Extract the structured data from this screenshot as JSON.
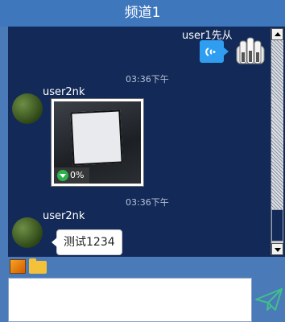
{
  "window": {
    "title": "频道1"
  },
  "messages": [
    {
      "user": "user1先从",
      "type": "voice",
      "side": "right"
    },
    {
      "time": "03:36下午"
    },
    {
      "user": "user2nk",
      "type": "image",
      "progress": "0%"
    },
    {
      "time": "03:36下午"
    },
    {
      "user": "user2nk",
      "type": "text",
      "text": "测试1234"
    }
  ],
  "icons": {
    "voice": "wifi-signal-icon",
    "image_tool": "image-icon",
    "folder_tool": "folder-icon",
    "send": "paper-plane-icon",
    "download": "download-arrow-icon"
  },
  "colors": {
    "titlebar": "#3f77bd",
    "chat_bg": "#132a58",
    "bubble_self": "#2f9ef0",
    "progress_green": "#2bb24c"
  }
}
